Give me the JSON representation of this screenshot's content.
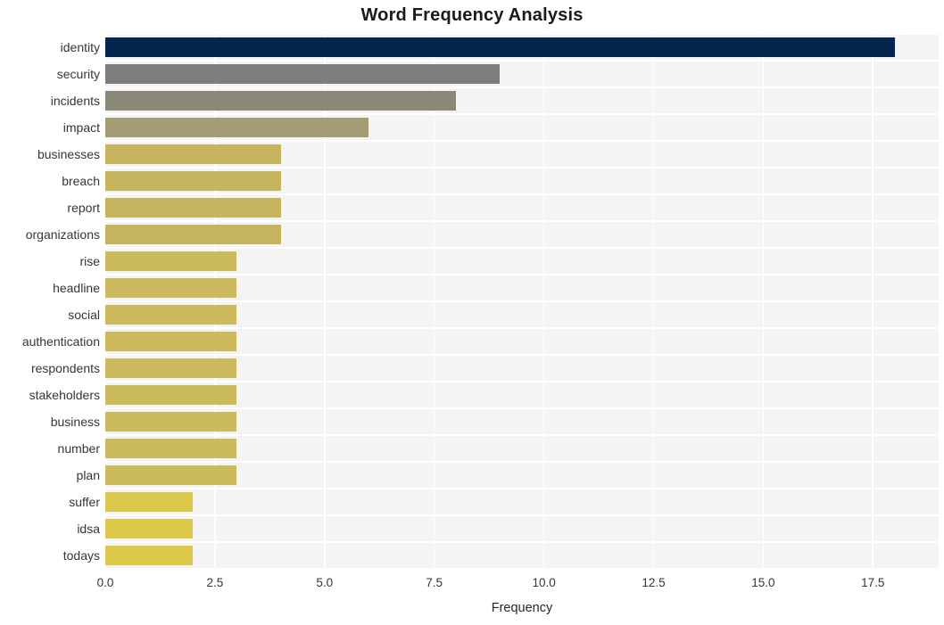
{
  "chart_data": {
    "type": "bar",
    "orientation": "horizontal",
    "title": "Word Frequency Analysis",
    "xlabel": "Frequency",
    "ylabel": "",
    "categories": [
      "identity",
      "security",
      "incidents",
      "impact",
      "businesses",
      "breach",
      "report",
      "organizations",
      "rise",
      "headline",
      "social",
      "authentication",
      "respondents",
      "stakeholders",
      "business",
      "number",
      "plan",
      "suffer",
      "idsa",
      "todays"
    ],
    "values": [
      18,
      9,
      8,
      6,
      4,
      4,
      4,
      4,
      3,
      3,
      3,
      3,
      3,
      3,
      3,
      3,
      3,
      2,
      2,
      2
    ],
    "bar_colors": [
      "#04254e",
      "#7d7d7b",
      "#8a8877",
      "#a39c75",
      "#c6b45e",
      "#c6b45e",
      "#c6b45e",
      "#c5b35f",
      "#ccbb5e",
      "#ccbb5e",
      "#ccbb5e",
      "#ccbb5e",
      "#ccbb5e",
      "#ccbb5e",
      "#ccbb5e",
      "#ccbb5e",
      "#ccbb5e",
      "#dcc94c",
      "#dcc94c",
      "#dcc94c"
    ],
    "xticks": [
      "0.0",
      "2.5",
      "5.0",
      "7.5",
      "10.0",
      "12.5",
      "15.0",
      "17.5"
    ],
    "xtick_values": [
      0,
      2.5,
      5,
      7.5,
      10,
      12.5,
      15,
      17.5
    ],
    "xlim": [
      0,
      19
    ],
    "grid": true,
    "legend": "none",
    "plot_background": "#f4f4f4",
    "grid_color": "#ffffff",
    "figure_background": "#ffffff"
  }
}
